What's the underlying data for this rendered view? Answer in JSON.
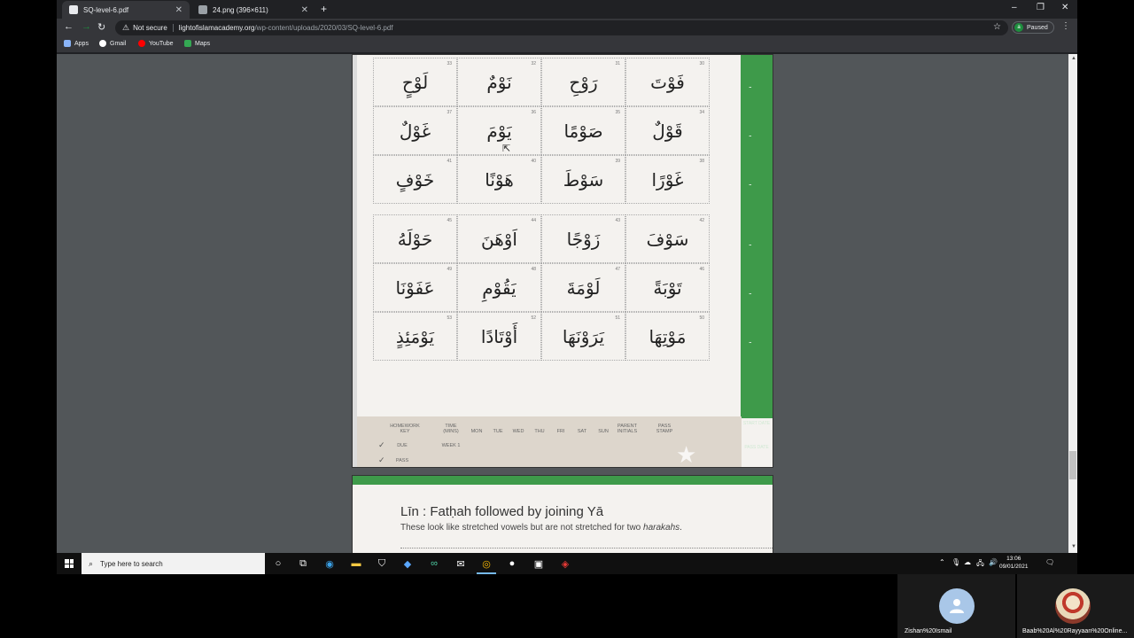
{
  "browser": {
    "tabs": [
      {
        "title": "SQ-level-6.pdf",
        "active": true,
        "icon": "pdf-icon"
      },
      {
        "title": "24.png (396×611)",
        "active": false,
        "icon": "image-icon"
      }
    ],
    "new_tab": "+",
    "window_controls": {
      "minimize": "‒",
      "restore": "❐",
      "close": "✕"
    },
    "nav": {
      "back": "←",
      "forward": "→",
      "reload": "↻"
    },
    "omnibox": {
      "security_icon": "⚠",
      "security_label": "Not secure",
      "host": "lightofislamacademy.org",
      "path": "/wp-content/uploads/2020/03/SQ-level-6.pdf",
      "star": "☆"
    },
    "profile": {
      "initial": "a",
      "label": "Paused"
    },
    "menu": "⋮",
    "bookmarks": [
      {
        "label": "Apps",
        "icon": "apps-grid-icon",
        "color": "#8ab4f8"
      },
      {
        "label": "Gmail",
        "icon": "google-icon",
        "color": "#ffffff"
      },
      {
        "label": "YouTube",
        "icon": "youtube-icon",
        "color": "#ff0000"
      },
      {
        "label": "Maps",
        "icon": "maps-icon",
        "color": "#34a853"
      }
    ]
  },
  "pdf": {
    "page1": {
      "grid_top": [
        {
          "num": "33",
          "word": "لَوْحٍ"
        },
        {
          "num": "32",
          "word": "نَوْمٌ"
        },
        {
          "num": "31",
          "word": "رَوْحِ"
        },
        {
          "num": "30",
          "word": "فَوْتَ"
        },
        {
          "num": "37",
          "word": "غَوْلٌ"
        },
        {
          "num": "36",
          "word": "يَوْمَ"
        },
        {
          "num": "35",
          "word": "صَوْمًا"
        },
        {
          "num": "34",
          "word": "قَوْلٌ"
        },
        {
          "num": "41",
          "word": "خَوْفٍ"
        },
        {
          "num": "40",
          "word": "هَوْنًا"
        },
        {
          "num": "39",
          "word": "سَوْطَ"
        },
        {
          "num": "38",
          "word": "غَوْرًا"
        }
      ],
      "grid_bottom": [
        {
          "num": "45",
          "word": "حَوْلَهُ"
        },
        {
          "num": "44",
          "word": "اَوْهَنَ"
        },
        {
          "num": "43",
          "word": "زَوْجًا"
        },
        {
          "num": "42",
          "word": "سَوْفَ"
        },
        {
          "num": "49",
          "word": "عَفَوْنَا"
        },
        {
          "num": "48",
          "word": "يَقُوْمِ"
        },
        {
          "num": "47",
          "word": "لَوْمَةَ"
        },
        {
          "num": "46",
          "word": "تَوْبَةً"
        },
        {
          "num": "53",
          "word": "يَوْمَئِذٍ"
        },
        {
          "num": "52",
          "word": "أَوْتَادًا"
        },
        {
          "num": "51",
          "word": "يَرَوْنَهَا"
        },
        {
          "num": "50",
          "word": "مَوْتِهَا"
        }
      ],
      "homework": {
        "key_label": "HOMEWORK KEY",
        "time_label": "TIME (MINS)",
        "days": [
          "MON",
          "TUE",
          "WED",
          "THU",
          "FRI",
          "SAT",
          "SUN"
        ],
        "parent": "PARENT INITIALS",
        "pass_stamp": "PASS STAMP",
        "due": "DUE",
        "pass": "PASS",
        "week": "WEEK 1",
        "start_date": "START DATE",
        "pass_date": "PASS DATE"
      },
      "green_marks": [
        "ـ",
        "ـ",
        "ـ",
        "ـ",
        "ـ",
        "ـ"
      ]
    },
    "page2": {
      "heading": "Līn : Fatḥah followed by joining Yā",
      "sub_plain": "These look like stretched vowels but are not stretched for two ",
      "sub_italic": "harakahs",
      "sub_end": "."
    }
  },
  "taskbar": {
    "search_placeholder": "Type here to search",
    "icons": [
      "cortana-icon",
      "task-view-icon",
      "edge-icon",
      "file-explorer-icon",
      "store-icon",
      "dropbox-icon",
      "infinity-icon",
      "mail-icon",
      "chrome-icon",
      "obs-icon",
      "photos-icon",
      "acrobat-icon"
    ],
    "tray": [
      "chevron-up-icon",
      "microphone-icon",
      "onedrive-icon",
      "network-icon",
      "volume-icon"
    ],
    "time": "13:06",
    "date": "09/01/2021"
  },
  "call": {
    "participants": [
      {
        "name": "Zishan%20Ismail"
      },
      {
        "name": "Baab%20Al%20Rayyaan%20Online..."
      }
    ]
  }
}
